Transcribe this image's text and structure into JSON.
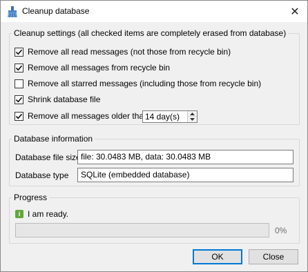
{
  "window": {
    "title": "Cleanup database",
    "close_symbol": "✕"
  },
  "cleanup": {
    "group_title": "Cleanup settings (all checked items are completely erased from database)",
    "options": [
      {
        "label": "Remove all read messages (not those from recycle bin)",
        "checked": true
      },
      {
        "label": "Remove all messages from recycle bin",
        "checked": true
      },
      {
        "label": "Remove all starred messages (including those from recycle bin)",
        "checked": false
      },
      {
        "label": "Shrink database file",
        "checked": true
      },
      {
        "label": "Remove all messages older than",
        "checked": true
      }
    ],
    "older_than_value": "14 day(s)"
  },
  "db_info": {
    "group_title": "Database information",
    "file_size_label": "Database file size",
    "file_size_value": "file: 30.0483 MB, data: 30.0483 MB",
    "type_label": "Database type",
    "type_value": "SQLite (embedded database)"
  },
  "progress": {
    "group_title": "Progress",
    "status_icon": "info-icon",
    "status_text": "I am ready.",
    "percent_text": "0%",
    "value": 0
  },
  "buttons": {
    "ok": "OK",
    "close": "Close"
  },
  "colors": {
    "accent": "#0078d7",
    "status_green": "#5fa83a"
  }
}
